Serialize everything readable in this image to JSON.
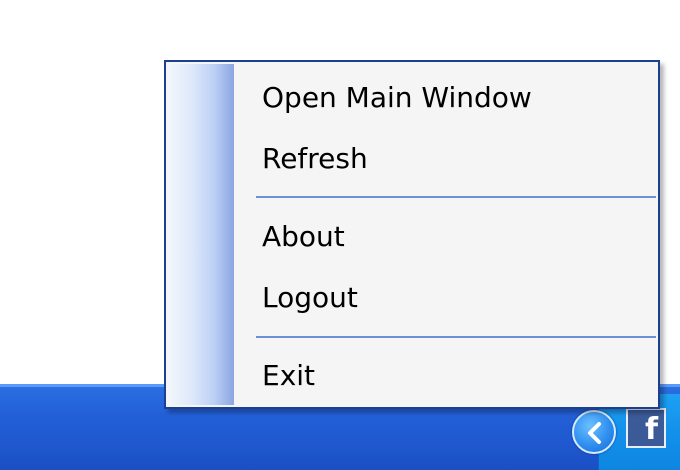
{
  "context_menu": {
    "items": [
      {
        "label": "Open Main Window"
      },
      {
        "label": "Refresh"
      },
      {
        "label": "About"
      },
      {
        "label": "Logout"
      },
      {
        "label": "Exit"
      }
    ]
  },
  "taskbar": {
    "tray_icons": [
      {
        "icon": "show-hidden-icons-chevron-icon"
      },
      {
        "icon": "facebook-icon",
        "glyph": "f"
      }
    ]
  },
  "colors": {
    "menu_border": "#1c3f94",
    "menu_background": "#f5f5f5",
    "separator": "#6d8fd6",
    "taskbar_blue": "#2360d8",
    "tray_blue": "#1290ea"
  }
}
